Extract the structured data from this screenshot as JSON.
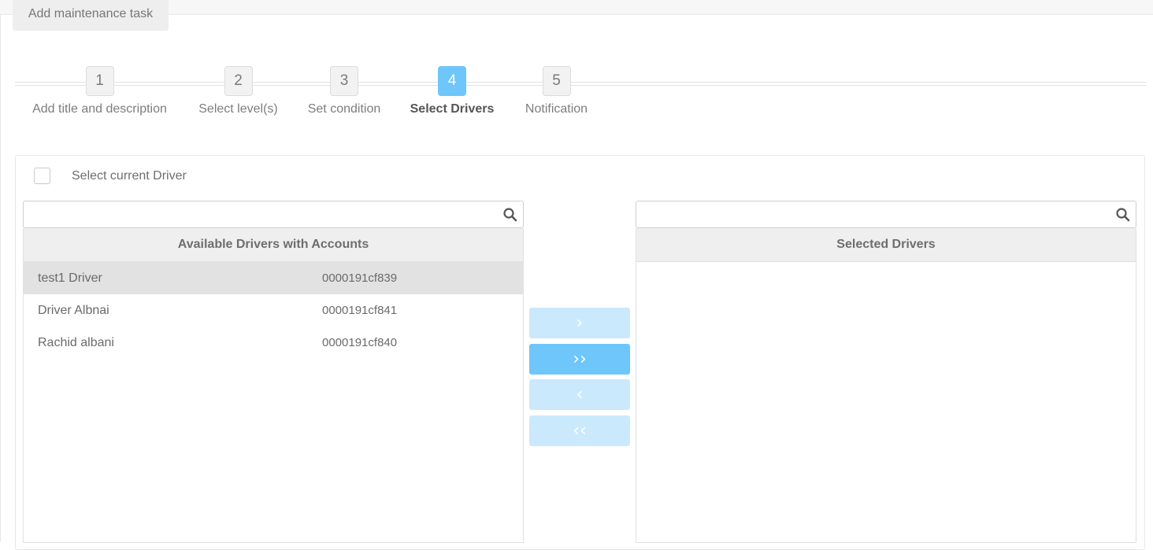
{
  "tab": {
    "label": "Add maintenance task"
  },
  "steps": [
    {
      "num": "1",
      "label": "Add title and description"
    },
    {
      "num": "2",
      "label": "Select level(s)"
    },
    {
      "num": "3",
      "label": "Set condition"
    },
    {
      "num": "4",
      "label": "Select Drivers"
    },
    {
      "num": "5",
      "label": "Notification"
    }
  ],
  "active_step": 4,
  "select_current": {
    "label": "Select current Driver",
    "checked": false
  },
  "available": {
    "search_value": "",
    "header": "Available Drivers with Accounts",
    "rows": [
      {
        "name": "test1 Driver",
        "account": "0000191cf839",
        "selected": true
      },
      {
        "name": "Driver Albnai",
        "account": "0000191cf841",
        "selected": false
      },
      {
        "name": "Rachid albani",
        "account": "0000191cf840",
        "selected": false
      }
    ]
  },
  "selected": {
    "search_value": "",
    "header": "Selected Drivers",
    "rows": []
  },
  "move_buttons": {
    "move_one": "›",
    "move_all": "››",
    "remove_one": "‹",
    "remove_all": "‹‹"
  },
  "icons": {
    "search": "search-icon"
  },
  "colors": {
    "accent": "#6ec6fb",
    "accent_light": "#cbe9fd",
    "row_selected": "#e2e2e2"
  }
}
